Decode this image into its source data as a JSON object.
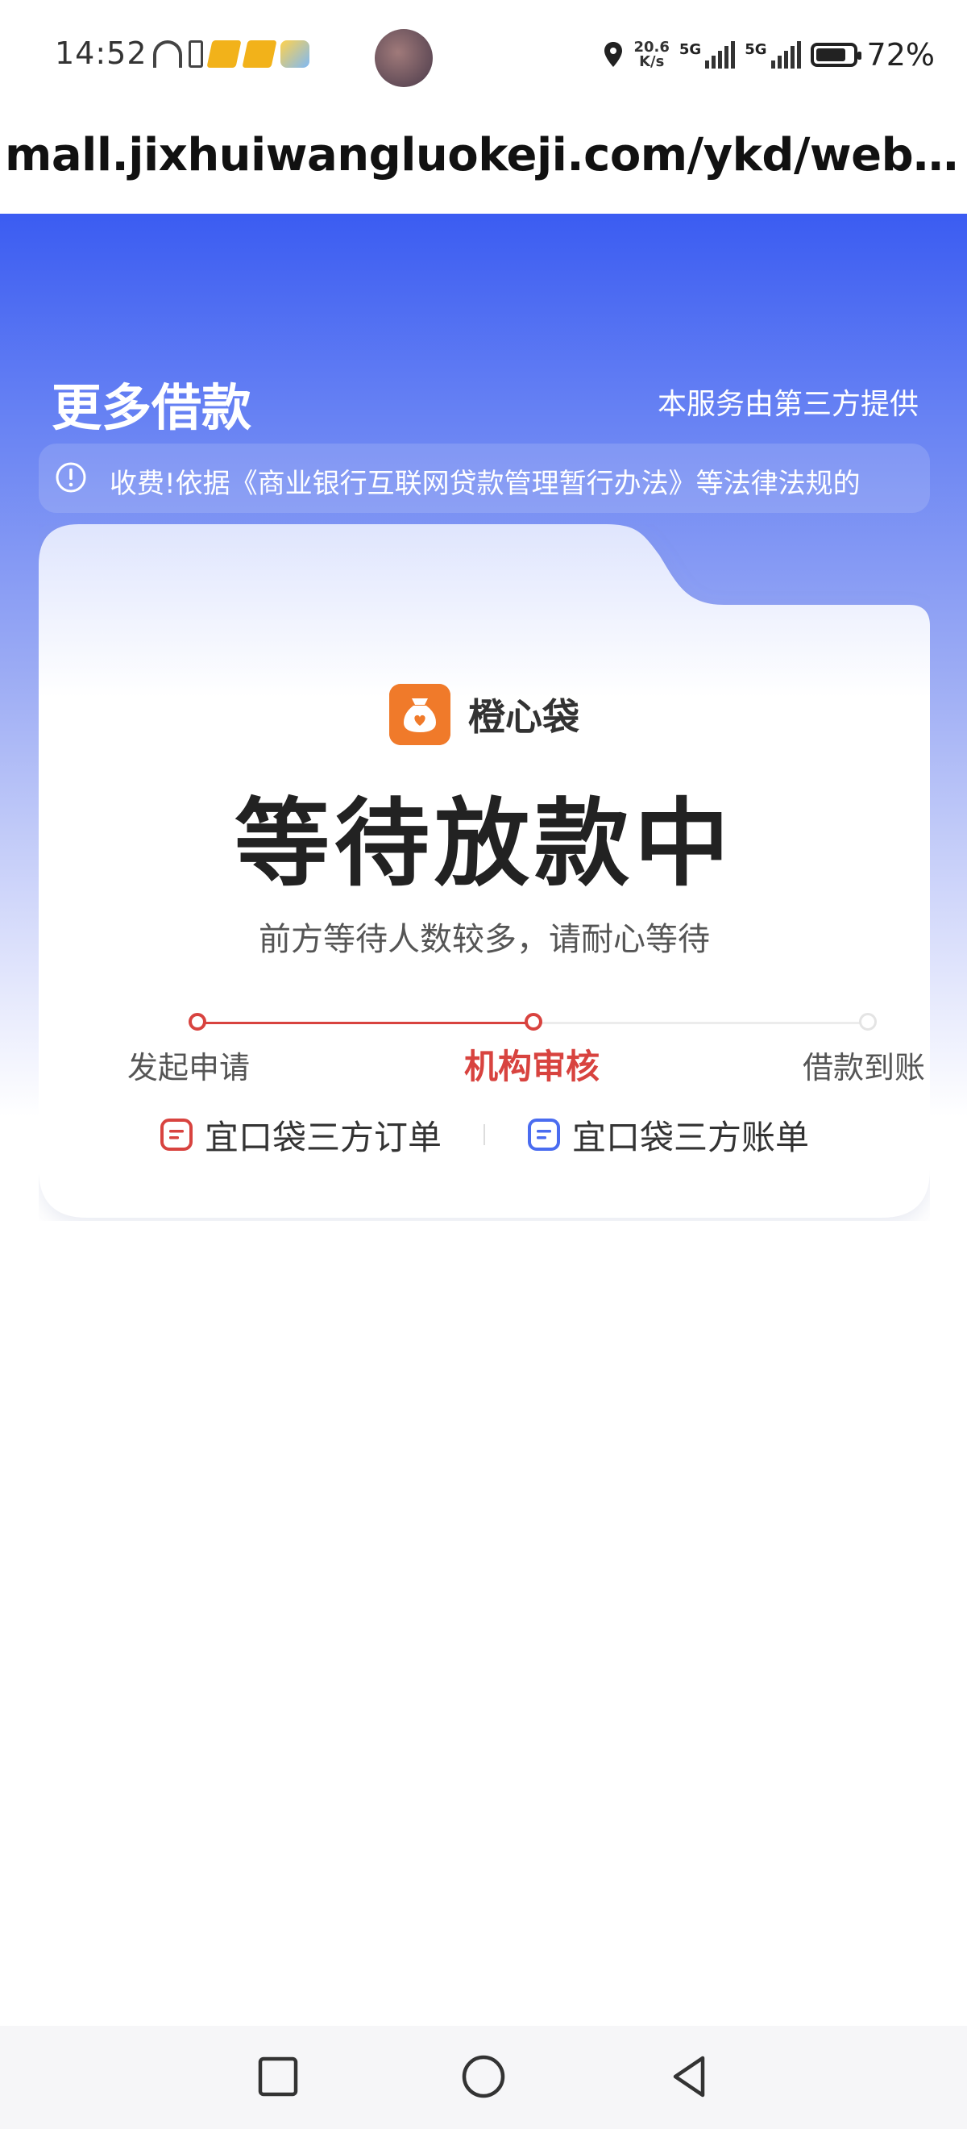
{
  "status_bar": {
    "time": "14:52",
    "net_speed_value": "20.6",
    "net_speed_unit": "K/s",
    "sim1": "5G",
    "sim2": "5G",
    "battery": "72%"
  },
  "browser": {
    "url": "mall.jixhuiwangluokeji.com/ykd/webapp..."
  },
  "header": {
    "title": "更多借款",
    "provider_note": "本服务由第三方提供"
  },
  "notice": {
    "text": "收费!依据《商业银行互联网贷款管理暂行办法》等法律法规的"
  },
  "card": {
    "brand_name": "橙心袋",
    "status_title": "等待放款中",
    "status_desc": "前方等待人数较多，请耐心等待",
    "steps": [
      {
        "label": "发起申请",
        "state": "done"
      },
      {
        "label": "机构审核",
        "state": "active"
      },
      {
        "label": "借款到账",
        "state": "todo"
      }
    ],
    "links": {
      "order": "宜口袋三方订单",
      "bill": "宜口袋三方账单"
    }
  },
  "colors": {
    "accent_red": "#d8433f",
    "hero_blue": "#3b5cf2",
    "brand_orange": "#f07a2a",
    "bill_blue": "#4a6cf0"
  },
  "icons": [
    "headset-icon",
    "battery-small-icon",
    "folder-icon",
    "weather-icon",
    "location-icon",
    "info-icon",
    "bag-logo-icon",
    "order-icon",
    "bill-icon",
    "square-icon",
    "circle-icon",
    "back-triangle-icon"
  ]
}
